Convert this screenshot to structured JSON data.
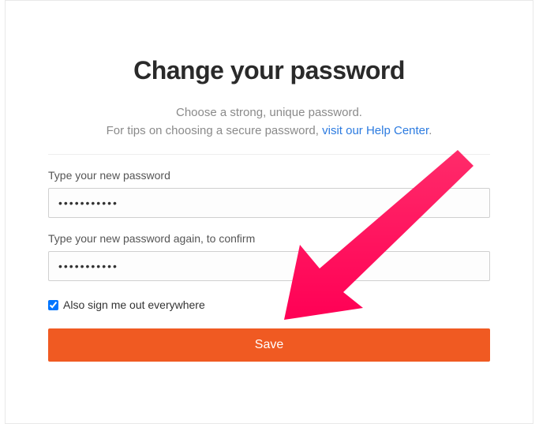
{
  "heading": "Change your password",
  "sub1": "Choose a strong, unique password.",
  "sub2_prefix": "For tips on choosing a secure password, ",
  "sub2_link": "visit our Help Center",
  "sub2_suffix": ".",
  "label_pw1": "Type your new password",
  "label_pw2": "Type your new password again, to confirm",
  "pw1_value": "•••••••••••",
  "pw2_value": "•••••••••••",
  "checkbox_label": "Also sign me out everywhere",
  "checkbox_checked": true,
  "save_label": "Save"
}
